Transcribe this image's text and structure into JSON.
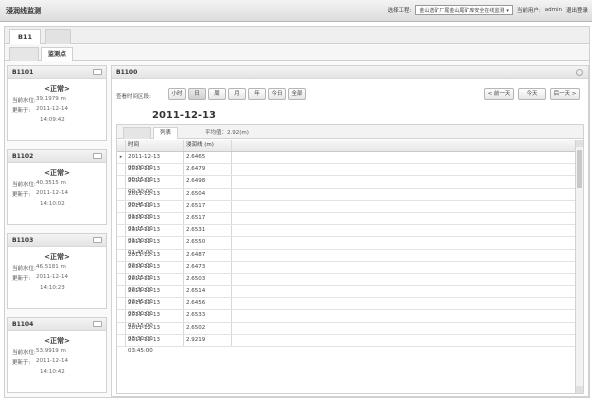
{
  "app": {
    "title": "浸润线监测"
  },
  "header": {
    "project_label": "选择工程:",
    "project_value": "金山选矿厂尾金山尾矿库安全在线监测",
    "user_label": "当前用户:",
    "user_name": "admin",
    "logout": "退出登录"
  },
  "tabs_top": [
    {
      "label": "B11"
    },
    {
      "label": ""
    }
  ],
  "tabs_sub": [
    {
      "label": ""
    },
    {
      "label": "监测点"
    }
  ],
  "cards": [
    {
      "title": "B1101",
      "status": "<正常>",
      "level_label": "当前水位:",
      "level": "39.1979 m",
      "time_label": "更新于:",
      "date": "2011-12-14",
      "time": "14:09:42"
    },
    {
      "title": "B1102",
      "status": "<正常>",
      "level_label": "当前水位:",
      "level": "40.3515 m",
      "time_label": "更新于:",
      "date": "2011-12-14",
      "time": "14:10:02"
    },
    {
      "title": "B1103",
      "status": "<正常>",
      "level_label": "当前水位:",
      "level": "46.5181 m",
      "time_label": "更新于:",
      "date": "2011-12-14",
      "time": "14:10:23"
    },
    {
      "title": "B1104",
      "status": "<正常>",
      "level_label": "当前水位:",
      "level": "53.9919 m",
      "time_label": "更新于:",
      "date": "2011-12-14",
      "time": "14:10:42"
    }
  ],
  "detail": {
    "title": "B1100",
    "range_label": "查看时间区段:",
    "range_buttons": [
      "小时",
      "日",
      "周",
      "月",
      "年",
      "今日",
      "全部"
    ],
    "nav_buttons": [
      "< 前一天",
      "今天",
      "后一天 >"
    ],
    "date": "2011-12-13",
    "inner_tabs": [
      "",
      "列表"
    ],
    "avg_label": "平均值：2.92(m)",
    "columns": [
      "时间",
      "浸润线 (m)"
    ],
    "rows": [
      [
        "2011-12-13 00:00:00",
        "2.6465"
      ],
      [
        "2011-12-13 00:15:00",
        "2.6479"
      ],
      [
        "2011-12-13 00:30:00",
        "2.6498"
      ],
      [
        "2011-12-13 00:45:00",
        "2.6504"
      ],
      [
        "2011-12-13 01:00:00",
        "2.6517"
      ],
      [
        "2011-12-13 01:15:00",
        "2.6517"
      ],
      [
        "2011-12-13 01:30:00",
        "2.6531"
      ],
      [
        "2011-12-13 01:45:00",
        "2.6550"
      ],
      [
        "2011-12-13 02:00:00",
        "2.6487"
      ],
      [
        "2011-12-13 02:15:00",
        "2.6473"
      ],
      [
        "2011-12-13 02:30:00",
        "2.6503"
      ],
      [
        "2011-12-13 02:45:00",
        "2.6514"
      ],
      [
        "2011-12-13 03:00:00",
        "2.6456"
      ],
      [
        "2011-12-13 03:15:00",
        "2.6533"
      ],
      [
        "2011-12-13 03:30:00",
        "2.6502"
      ],
      [
        "2011-12-13 03:45:00",
        "2.9219"
      ]
    ]
  }
}
